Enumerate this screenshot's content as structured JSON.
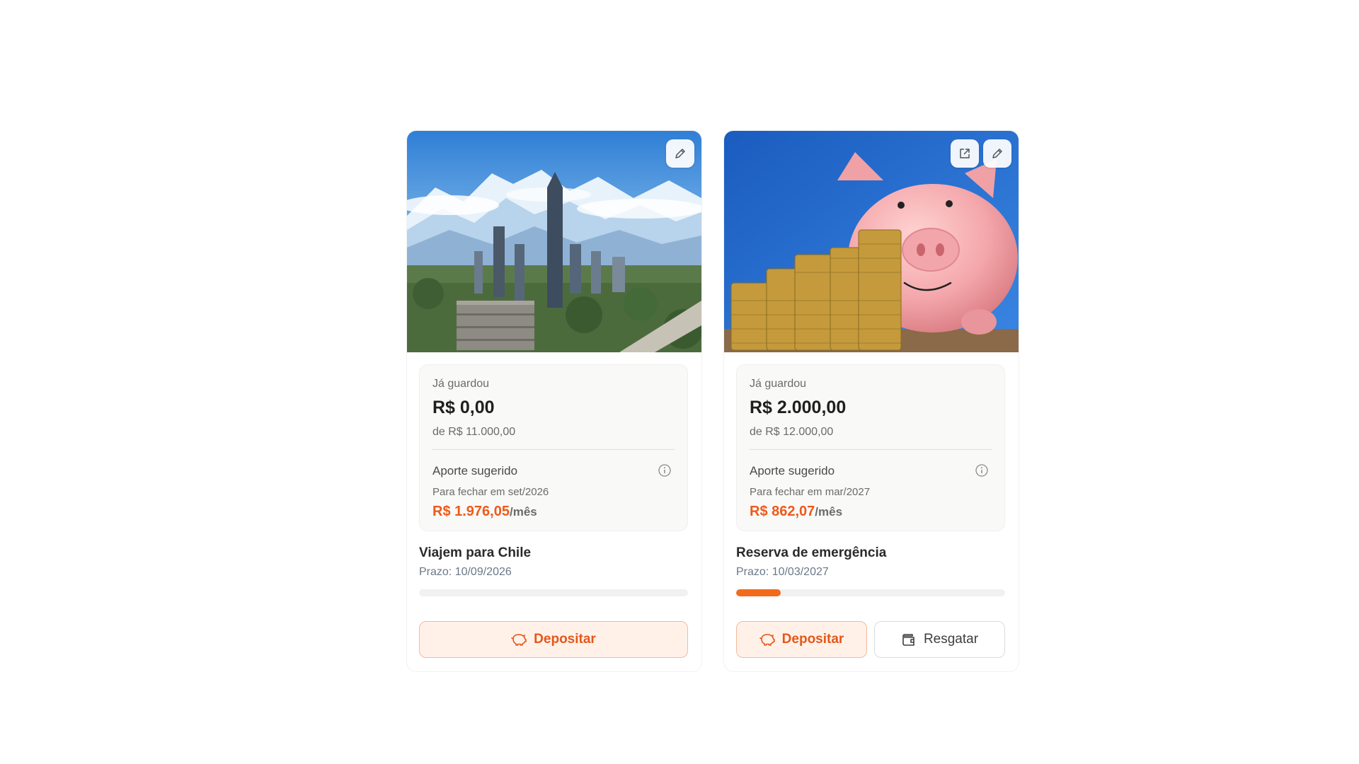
{
  "colors": {
    "accent": "#ee5a1a",
    "accent_bg": "#fff1e8",
    "progress_track": "#f1f1f1"
  },
  "goals": [
    {
      "name": "Viajem para Chile",
      "image": "santiago-skyline-andes",
      "saved_label": "Já guardou",
      "saved_amount": "R$ 0,00",
      "goal_total": "de R$ 11.000,00",
      "contribution_title": "Aporte sugerido",
      "close_date": "Para fechar em set/2026",
      "monthly_amount": "R$ 1.976,05",
      "per_month": "/mês",
      "deadline": "Prazo: 10/09/2026",
      "progress": 0,
      "actions": {
        "deposit": "Depositar"
      }
    },
    {
      "name": "Reserva de emergência",
      "image": "piggy-bank-coins",
      "saved_label": "Já guardou",
      "saved_amount": "R$ 2.000,00",
      "goal_total": "de R$ 12.000,00",
      "contribution_title": "Aporte sugerido",
      "close_date": "Para fechar em mar/2027",
      "monthly_amount": "R$ 862,07",
      "per_month": "/mês",
      "deadline": "Prazo: 10/03/2027",
      "progress": 0.1667,
      "actions": {
        "deposit": "Depositar",
        "withdraw": "Resgatar"
      }
    }
  ]
}
